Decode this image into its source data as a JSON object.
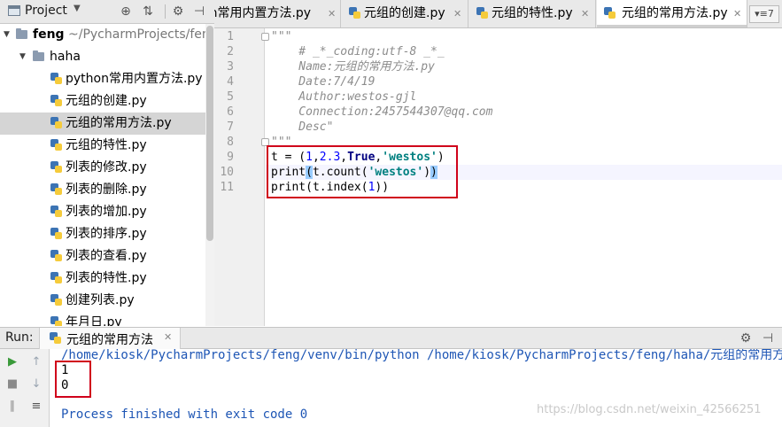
{
  "project_panel": {
    "title": "Project",
    "dropdown_icon": "chevron-down-icon",
    "toolbar_icons": [
      "crosshair-icon",
      "collapse-all-icon",
      "gear-icon",
      "hide-icon"
    ]
  },
  "tree": {
    "root": {
      "name": "feng",
      "path": "~/PycharmProjects/feng"
    },
    "folder": {
      "name": "haha"
    },
    "files": [
      "python常用内置方法.py",
      "元组的创建.py",
      "元组的常用方法.py",
      "元组的特性.py",
      "列表的修改.py",
      "列表的删除.py",
      "列表的增加.py",
      "列表的排序.py",
      "列表的查看.py",
      "列表的特性.py",
      "创建列表.py",
      "年月日.py"
    ],
    "selected": "元组的常用方法.py"
  },
  "tabs": [
    {
      "label": "on常用内置方法.py",
      "active": false
    },
    {
      "label": "元组的创建.py",
      "active": false
    },
    {
      "label": "元组的特性.py",
      "active": false
    },
    {
      "label": "元组的常用方法.py",
      "active": true
    }
  ],
  "tab_overflow": "▾≡7",
  "editor": {
    "line_numbers": [
      "1",
      "2",
      "3",
      "4",
      "5",
      "6",
      "7",
      "8",
      "9",
      "10",
      "11"
    ],
    "current_line": 10,
    "lines": [
      "\"\"\"",
      "    # _*_coding:utf-8 _*_",
      "    Name:元组的常用方法.py",
      "    Date:7/4/19",
      "    Author:westos-gjl",
      "    Connection:2457544307@qq.com",
      "    Desc\"",
      "\"\"\"",
      "t = (1,2.3,True,'westos')",
      "print(t.count('westos'))",
      "print(t.index(1))"
    ]
  },
  "run": {
    "label": "Run:",
    "tab_label": "元组的常用方法",
    "command": "/home/kiosk/PycharmProjects/feng/venv/bin/python /home/kiosk/PycharmProjects/feng/haha/元组的常用方法.py",
    "output": [
      "1",
      "0"
    ],
    "finish": "Process finished with exit code 0"
  },
  "watermark": "https://blog.csdn.net/weixin_42566251",
  "colors": {
    "accent_red": "#d0021b",
    "keyword": "#000080",
    "string": "#008080",
    "number": "#0000ff",
    "docstring": "#8c8c8c"
  }
}
